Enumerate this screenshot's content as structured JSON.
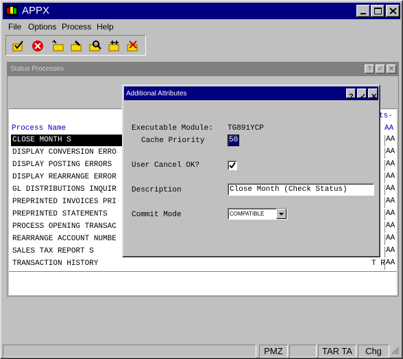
{
  "app": {
    "title": "APPX"
  },
  "menu": [
    "File",
    "Options",
    "Process",
    "Help"
  ],
  "toolbar": [
    "check-select-icon",
    "cancel-icon",
    "add-icon",
    "change-icon",
    "inquire-icon",
    "scan-icon",
    "delete-icon"
  ],
  "status_window": {
    "title": "Status Processes",
    "col_process_name": "Process Name",
    "col_right_top": "ts-",
    "col_right": "AA",
    "rows": [
      {
        "name": "CLOSE MONTH S",
        "aa": "AA"
      },
      {
        "name": "DISPLAY CONVERSION ERRO",
        "aa": "AA"
      },
      {
        "name": "DISPLAY POSTING ERRORS",
        "aa": "AA"
      },
      {
        "name": "DISPLAY REARRANGE ERROR",
        "aa": "AA"
      },
      {
        "name": "GL DISTRIBUTIONS INQUIR",
        "aa": "AA"
      },
      {
        "name": "PREPRINTED INVOICES PRI",
        "aa": "AA"
      },
      {
        "name": "PREPRINTED STATEMENTS",
        "aa": "AA"
      },
      {
        "name": "PROCESS OPENING TRANSAC",
        "aa": "AA"
      },
      {
        "name": "REARRANGE ACCOUNT NUMBE",
        "aa": "AA"
      },
      {
        "name": "SALES TAX REPORT S",
        "aa": "AA"
      },
      {
        "name": "TRANSACTION HISTORY",
        "aa": "AA",
        "extra": "T R"
      }
    ]
  },
  "dialog": {
    "title": "Additional Attributes",
    "exec_module_label": "Executable Module:",
    "exec_module_value": "TG891YCP",
    "cache_label": "Cache Priority",
    "cache_value": "50",
    "user_cancel_label": "User Cancel OK?",
    "user_cancel_checked": true,
    "description_label": "Description",
    "description_value": "Close Month (Check Status)",
    "commit_label": "Commit Mode",
    "commit_value": "COMPATIBLE"
  },
  "statusbar": [
    "PMZ",
    "TAR TA",
    "Chg"
  ]
}
